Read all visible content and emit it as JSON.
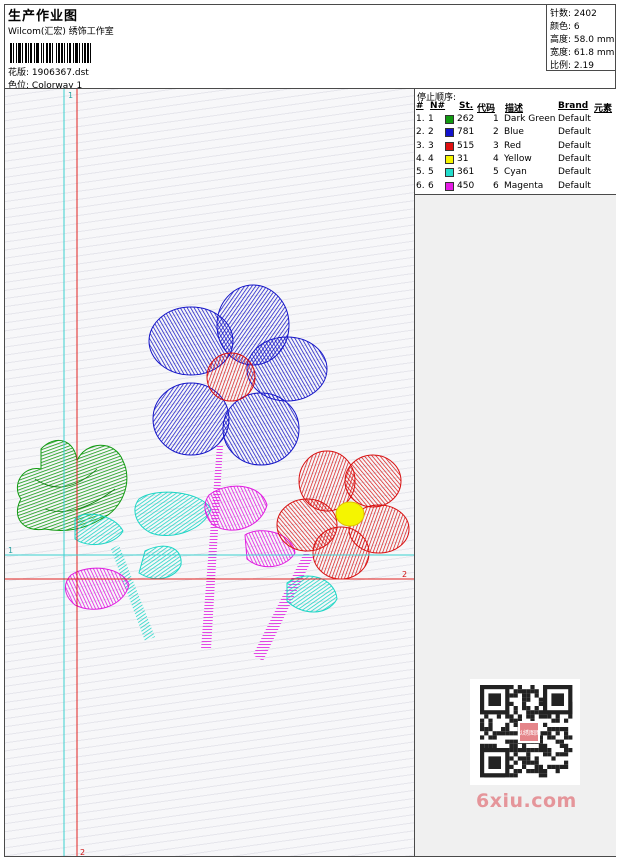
{
  "header": {
    "title": "生产作业图",
    "studio": "Wilcom(汇宏) 绣饰工作室",
    "design_label": "花版:",
    "design_value": "1906367.dst",
    "colorway_label": "色位:",
    "colorway_value": "Colorway 1"
  },
  "stats": [
    {
      "label": "针数:",
      "value": "2402"
    },
    {
      "label": "颜色:",
      "value": "6"
    },
    {
      "label": "高度:",
      "value": "58.0 mm"
    },
    {
      "label": "宽度:",
      "value": "61.8 mm"
    },
    {
      "label": "比例:",
      "value": "2.19"
    }
  ],
  "sequence": {
    "title": "停止顺序:",
    "headers": [
      "#",
      "N#",
      "St.",
      "代码",
      "描述",
      "Brand",
      "元素"
    ],
    "rows": [
      {
        "idx": "1.",
        "n": "1",
        "stitches": "262",
        "code": "1",
        "desc": "Dark Green",
        "brand": "Default",
        "color": "#119a11"
      },
      {
        "idx": "2.",
        "n": "2",
        "stitches": "781",
        "code": "2",
        "desc": "Blue",
        "brand": "Default",
        "color": "#1212cc"
      },
      {
        "idx": "3.",
        "n": "3",
        "stitches": "515",
        "code": "3",
        "desc": "Red",
        "brand": "Default",
        "color": "#e01010"
      },
      {
        "idx": "4.",
        "n": "4",
        "stitches": "31",
        "code": "4",
        "desc": "Yellow",
        "brand": "Default",
        "color": "#f5f500"
      },
      {
        "idx": "5.",
        "n": "5",
        "stitches": "361",
        "code": "5",
        "desc": "Cyan",
        "brand": "Default",
        "color": "#22dccc"
      },
      {
        "idx": "6.",
        "n": "6",
        "stitches": "450",
        "code": "6",
        "desc": "Magenta",
        "brand": "Default",
        "color": "#e51ce5"
      }
    ]
  },
  "guides": {
    "v1": "1",
    "v2": "2",
    "h1": "1",
    "h2": "2",
    "cyan": "#3ad0d0",
    "red": "#e02020"
  },
  "watermark": "6xiu.com",
  "qr_stamp": "以绣图图"
}
